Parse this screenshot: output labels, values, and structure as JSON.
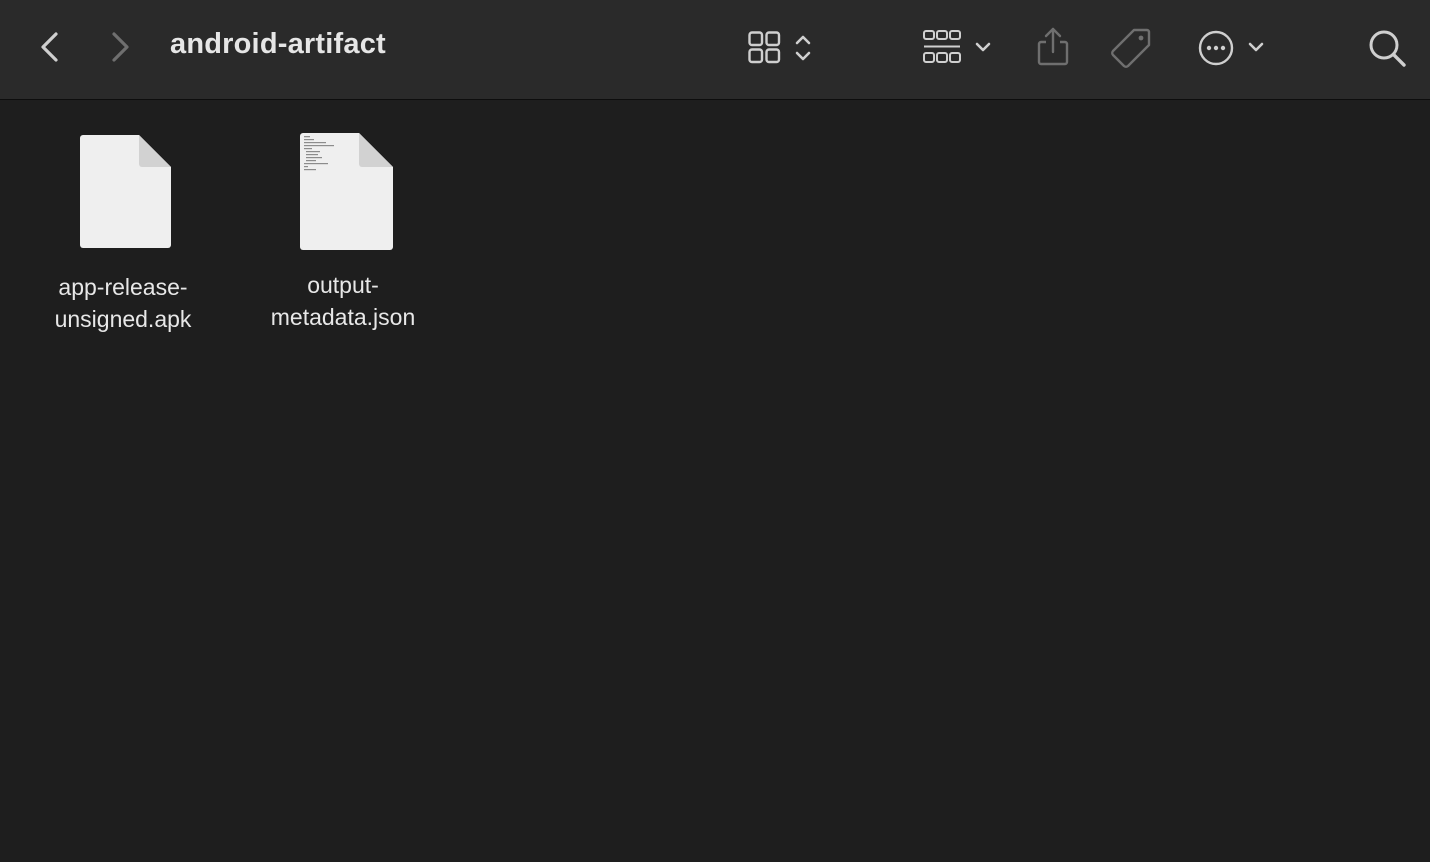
{
  "window": {
    "title": "android-artifact"
  },
  "toolbar": {
    "back_icon": "chevron-left-icon",
    "forward_icon": "chevron-right-icon",
    "view_mode_icon": "icon-grid-view-icon",
    "group_icon": "group-by-icon",
    "share_icon": "share-icon",
    "tag_icon": "tag-icon",
    "more_icon": "ellipsis-circle-icon",
    "search_icon": "search-icon"
  },
  "files": [
    {
      "name": "app-release-\nunsigned.apk",
      "kind": "generic-document-icon"
    },
    {
      "name": "output-\nmetadata.json",
      "kind": "text-document-icon"
    }
  ],
  "colors": {
    "background": "#1e1e1e",
    "toolbar": "#2a2a2a",
    "icon_active": "#cfcfcf",
    "icon_disabled": "#6f6f6f",
    "text": "#e8e8e8"
  }
}
